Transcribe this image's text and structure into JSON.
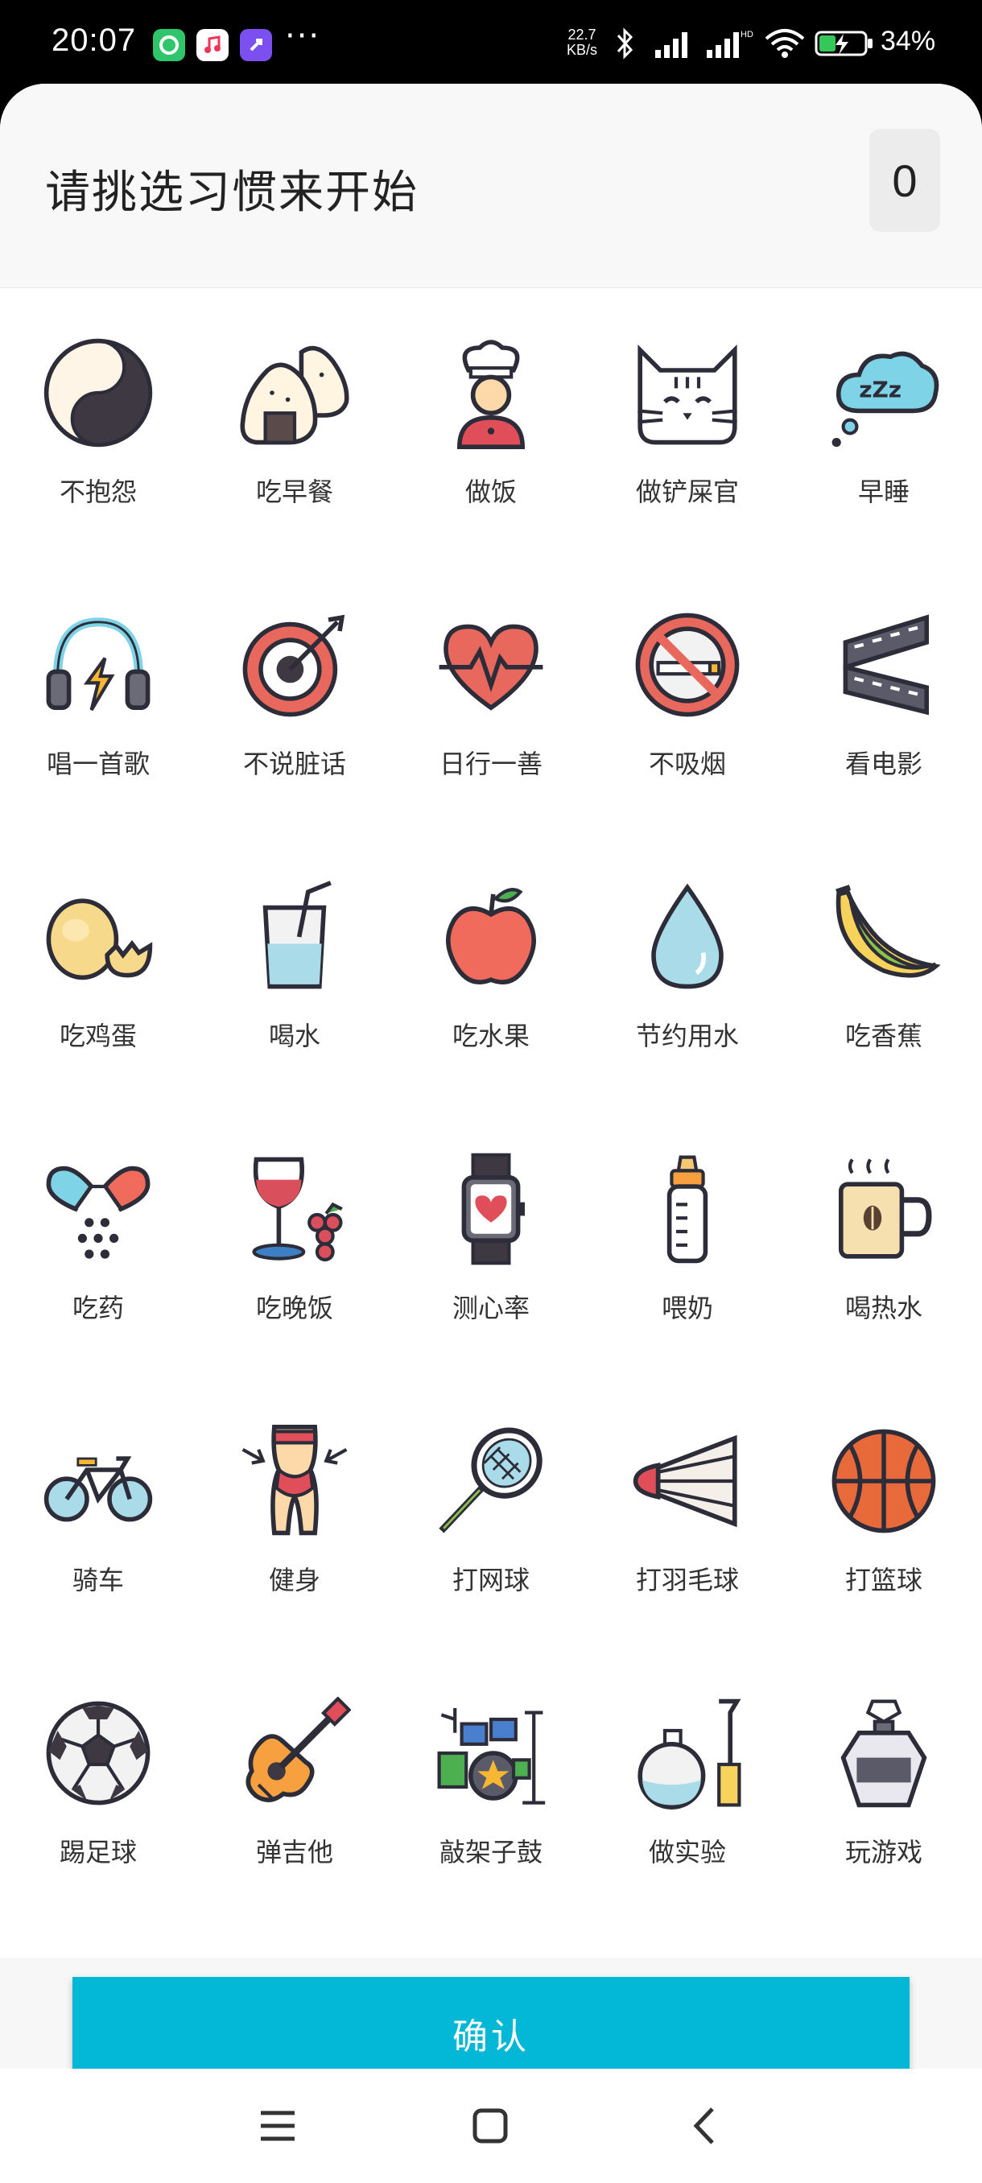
{
  "status_bar": {
    "time": "20:07",
    "more": "···",
    "net_speed_value": "22.7",
    "net_speed_unit": "KB/s",
    "battery_text": "34%",
    "app_icons": [
      "green-app-icon",
      "music-app-icon",
      "rocket-app-icon"
    ]
  },
  "sheet": {
    "title": "请挑选习惯来开始",
    "count": "0"
  },
  "habits": [
    {
      "label": "不抱怨",
      "icon": "yin-yang-icon"
    },
    {
      "label": "吃早餐",
      "icon": "onigiri-icon"
    },
    {
      "label": "做饭",
      "icon": "chef-icon"
    },
    {
      "label": "做铲屎官",
      "icon": "cat-icon"
    },
    {
      "label": "早睡",
      "icon": "sleep-cloud-icon"
    },
    {
      "label": "唱一首歌",
      "icon": "headphones-icon"
    },
    {
      "label": "不说脏话",
      "icon": "target-icon"
    },
    {
      "label": "日行一善",
      "icon": "heartbeat-icon"
    },
    {
      "label": "不吸烟",
      "icon": "no-smoking-icon"
    },
    {
      "label": "看电影",
      "icon": "film-strip-icon"
    },
    {
      "label": "吃鸡蛋",
      "icon": "egg-icon"
    },
    {
      "label": "喝水",
      "icon": "water-glass-icon"
    },
    {
      "label": "吃水果",
      "icon": "apple-icon"
    },
    {
      "label": "节约用水",
      "icon": "water-drop-icon"
    },
    {
      "label": "吃香蕉",
      "icon": "banana-icon"
    },
    {
      "label": "吃药",
      "icon": "pills-icon"
    },
    {
      "label": "吃晚饭",
      "icon": "wine-grapes-icon"
    },
    {
      "label": "测心率",
      "icon": "smartwatch-icon"
    },
    {
      "label": "喂奶",
      "icon": "baby-bottle-icon"
    },
    {
      "label": "喝热水",
      "icon": "hot-mug-icon"
    },
    {
      "label": "骑车",
      "icon": "bicycle-icon"
    },
    {
      "label": "健身",
      "icon": "fitness-body-icon"
    },
    {
      "label": "打网球",
      "icon": "tennis-racket-icon"
    },
    {
      "label": "打羽毛球",
      "icon": "shuttlecock-icon"
    },
    {
      "label": "打篮球",
      "icon": "basketball-icon"
    },
    {
      "label": "踢足球",
      "icon": "soccer-ball-icon"
    },
    {
      "label": "弹吉他",
      "icon": "guitar-icon"
    },
    {
      "label": "敲架子鼓",
      "icon": "drum-kit-icon"
    },
    {
      "label": "做实验",
      "icon": "lab-flask-icon"
    },
    {
      "label": "玩游戏",
      "icon": "perfume-bottle-icon"
    }
  ],
  "footer": {
    "confirm_label": "确认"
  },
  "navbar": {
    "items": [
      "menu-icon",
      "home-icon",
      "back-icon"
    ]
  }
}
